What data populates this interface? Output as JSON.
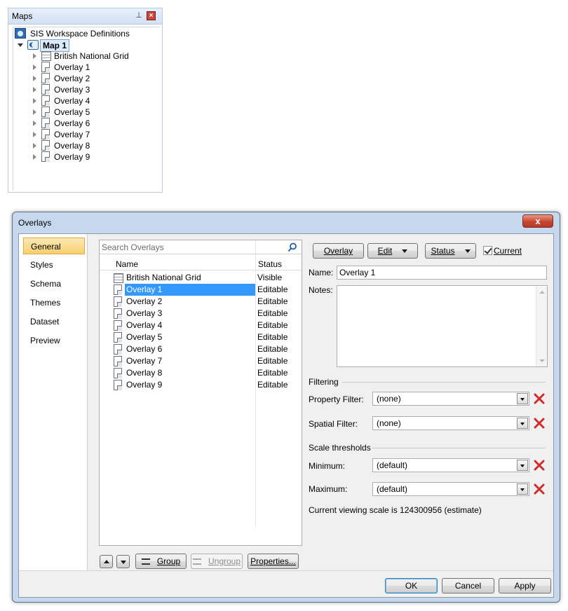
{
  "maps_panel": {
    "title": "Maps",
    "pin_icon": "pin-icon",
    "close_icon": "close-icon",
    "tree": {
      "root_label": "SIS Workspace Definitions",
      "map_label": "Map 1",
      "nodes": [
        "British National Grid",
        "Overlay 1",
        "Overlay 2",
        "Overlay 3",
        "Overlay 4",
        "Overlay 5",
        "Overlay 6",
        "Overlay 7",
        "Overlay 8",
        "Overlay 9"
      ]
    }
  },
  "dialog": {
    "title": "Overlays",
    "close_label": "x",
    "nav": {
      "items": [
        "General",
        "Styles",
        "Schema",
        "Themes",
        "Dataset",
        "Preview"
      ],
      "active": "General"
    },
    "list": {
      "search_placeholder": "Search Overlays",
      "columns": {
        "name": "Name",
        "status": "Status"
      },
      "rows": [
        {
          "name": "British National Grid",
          "status": "Visible",
          "icon": "grid-icon"
        },
        {
          "name": "Overlay 1",
          "status": "Editable",
          "icon": "overlay-icon",
          "selected": true
        },
        {
          "name": "Overlay 2",
          "status": "Editable",
          "icon": "overlay-icon"
        },
        {
          "name": "Overlay 3",
          "status": "Editable",
          "icon": "overlay-icon"
        },
        {
          "name": "Overlay 4",
          "status": "Editable",
          "icon": "overlay-icon"
        },
        {
          "name": "Overlay 5",
          "status": "Editable",
          "icon": "overlay-icon"
        },
        {
          "name": "Overlay 6",
          "status": "Editable",
          "icon": "overlay-icon"
        },
        {
          "name": "Overlay 7",
          "status": "Editable",
          "icon": "overlay-icon"
        },
        {
          "name": "Overlay 8",
          "status": "Editable",
          "icon": "overlay-icon"
        },
        {
          "name": "Overlay 9",
          "status": "Editable",
          "icon": "overlay-icon"
        }
      ],
      "buttons": {
        "group": "Group",
        "ungroup": "Ungroup",
        "properties": "Properties..."
      }
    },
    "toolbar": {
      "overlay": "Overlay",
      "edit": "Edit",
      "status": "Status",
      "current_label": "Current",
      "current_checked": true
    },
    "form": {
      "name_label": "Name:",
      "name_value": "Overlay 1",
      "notes_label": "Notes:",
      "notes_value": "",
      "filtering_header": "Filtering",
      "property_filter_label": "Property Filter:",
      "property_filter_value": "(none)",
      "spatial_filter_label": "Spatial Filter:",
      "spatial_filter_value": "(none)",
      "scale_header": "Scale thresholds",
      "minimum_label": "Minimum:",
      "minimum_value": "(default)",
      "maximum_label": "Maximum:",
      "maximum_value": "(default)",
      "scale_note": "Current viewing scale is 124300956 (estimate)"
    },
    "footer": {
      "ok": "OK",
      "cancel": "Cancel",
      "apply": "Apply"
    },
    "colors": {
      "selection": "#3399ff",
      "nav_active": "#f8cf6e",
      "clear_icon": "#d12b2b",
      "title_bar": "#c6d8ee"
    }
  }
}
